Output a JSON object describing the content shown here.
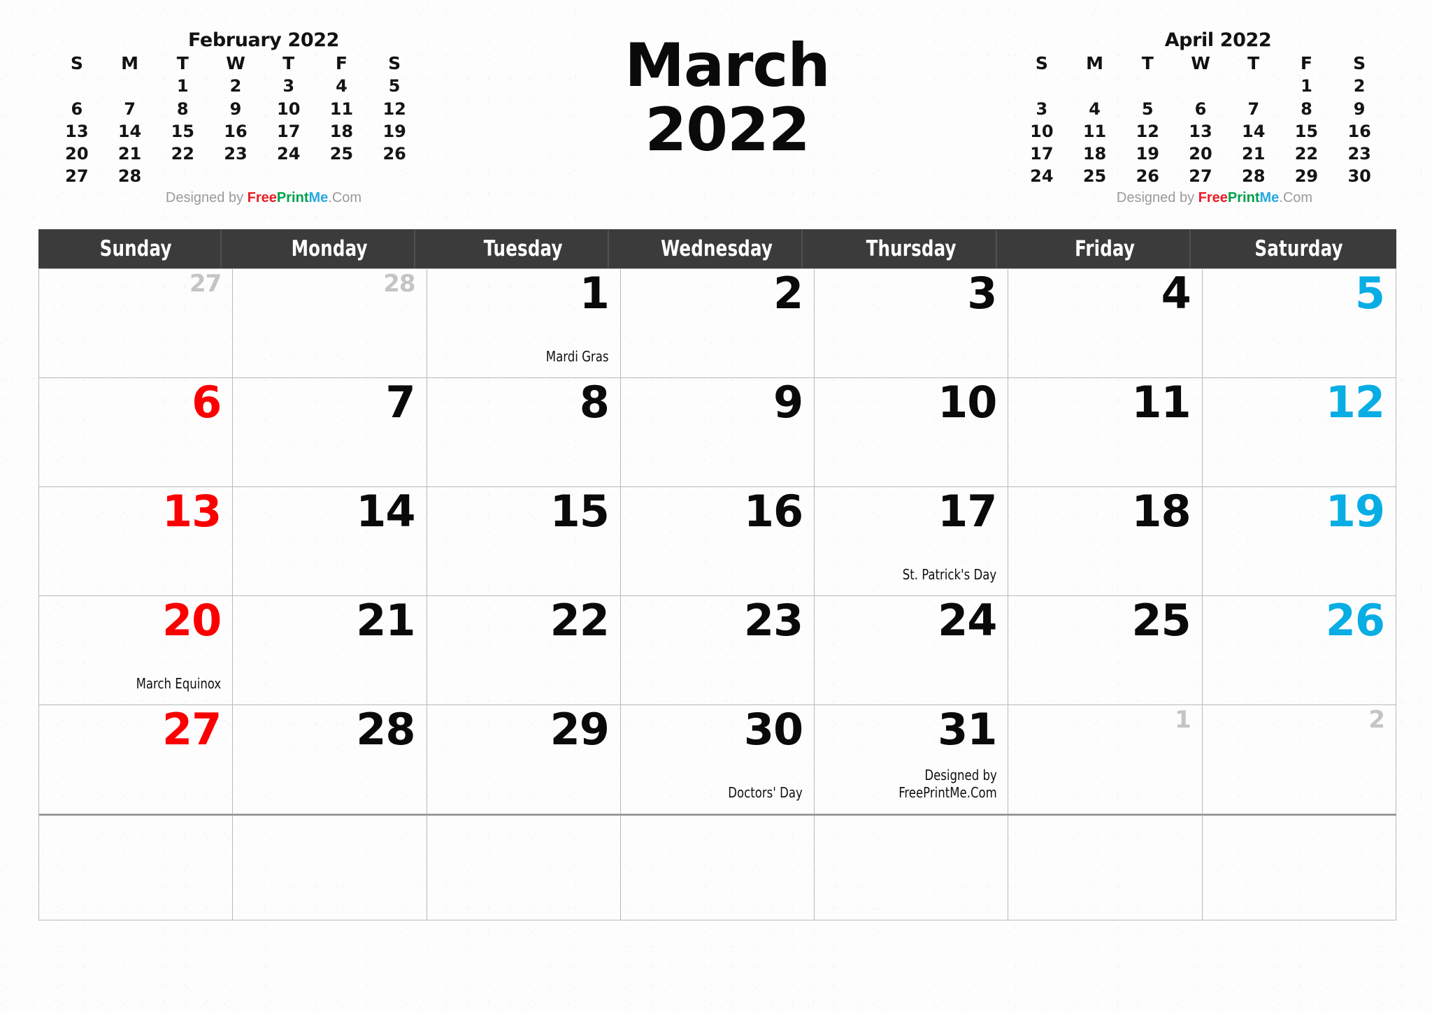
{
  "title": {
    "month": "March",
    "year": "2022"
  },
  "credit": {
    "prefix": "Designed by ",
    "free": "Free",
    "print": "Print",
    "me": "Me",
    "dotcom": ".Com",
    "colors": {
      "free": "#ec1c24",
      "print": "#00a14b",
      "me": "#27aae1",
      "plain": "#9a9a9a"
    }
  },
  "colors": {
    "header_bg": "#3b3b3b",
    "header_text": "#ffffff",
    "sunday": "#fb0000",
    "saturday": "#08ade4",
    "weekday": "#0a0a0a",
    "outside_day": "#c4c4c4",
    "grid_line": "#b9b9b9",
    "page_bg": "#fdfdfe"
  },
  "mini_calendars": [
    {
      "id": "february",
      "title": "February 2022",
      "dow": [
        "S",
        "M",
        "T",
        "W",
        "T",
        "F",
        "S"
      ],
      "weeks": [
        [
          "",
          "",
          "1",
          "2",
          "3",
          "4",
          "5"
        ],
        [
          "6",
          "7",
          "8",
          "9",
          "10",
          "11",
          "12"
        ],
        [
          "13",
          "14",
          "15",
          "16",
          "17",
          "18",
          "19"
        ],
        [
          "20",
          "21",
          "22",
          "23",
          "24",
          "25",
          "26"
        ],
        [
          "27",
          "28",
          "",
          "",
          "",
          "",
          ""
        ]
      ]
    },
    {
      "id": "april",
      "title": "April 2022",
      "dow": [
        "S",
        "M",
        "T",
        "W",
        "T",
        "F",
        "S"
      ],
      "weeks": [
        [
          "",
          "",
          "",
          "",
          "",
          "1",
          "2"
        ],
        [
          "3",
          "4",
          "5",
          "6",
          "7",
          "8",
          "9"
        ],
        [
          "10",
          "11",
          "12",
          "13",
          "14",
          "15",
          "16"
        ],
        [
          "17",
          "18",
          "19",
          "20",
          "21",
          "22",
          "23"
        ],
        [
          "24",
          "25",
          "26",
          "27",
          "28",
          "29",
          "30"
        ]
      ]
    }
  ],
  "weekday_headers": [
    "Sunday",
    "Monday",
    "Tuesday",
    "Wednesday",
    "Thursday",
    "Friday",
    "Saturday"
  ],
  "weeks": [
    [
      {
        "num": "27",
        "outside": true,
        "event": ""
      },
      {
        "num": "28",
        "outside": true,
        "event": ""
      },
      {
        "num": "1",
        "outside": false,
        "event": "Mardi Gras"
      },
      {
        "num": "2",
        "outside": false,
        "event": ""
      },
      {
        "num": "3",
        "outside": false,
        "event": ""
      },
      {
        "num": "4",
        "outside": false,
        "event": ""
      },
      {
        "num": "5",
        "outside": false,
        "event": ""
      }
    ],
    [
      {
        "num": "6",
        "outside": false,
        "event": ""
      },
      {
        "num": "7",
        "outside": false,
        "event": ""
      },
      {
        "num": "8",
        "outside": false,
        "event": ""
      },
      {
        "num": "9",
        "outside": false,
        "event": ""
      },
      {
        "num": "10",
        "outside": false,
        "event": ""
      },
      {
        "num": "11",
        "outside": false,
        "event": ""
      },
      {
        "num": "12",
        "outside": false,
        "event": ""
      }
    ],
    [
      {
        "num": "13",
        "outside": false,
        "event": ""
      },
      {
        "num": "14",
        "outside": false,
        "event": ""
      },
      {
        "num": "15",
        "outside": false,
        "event": ""
      },
      {
        "num": "16",
        "outside": false,
        "event": ""
      },
      {
        "num": "17",
        "outside": false,
        "event": "St. Patrick's Day"
      },
      {
        "num": "18",
        "outside": false,
        "event": ""
      },
      {
        "num": "19",
        "outside": false,
        "event": ""
      }
    ],
    [
      {
        "num": "20",
        "outside": false,
        "event": "March Equinox"
      },
      {
        "num": "21",
        "outside": false,
        "event": ""
      },
      {
        "num": "22",
        "outside": false,
        "event": ""
      },
      {
        "num": "23",
        "outside": false,
        "event": ""
      },
      {
        "num": "24",
        "outside": false,
        "event": ""
      },
      {
        "num": "25",
        "outside": false,
        "event": ""
      },
      {
        "num": "26",
        "outside": false,
        "event": ""
      }
    ],
    [
      {
        "num": "27",
        "outside": false,
        "event": ""
      },
      {
        "num": "28",
        "outside": false,
        "event": ""
      },
      {
        "num": "29",
        "outside": false,
        "event": ""
      },
      {
        "num": "30",
        "outside": false,
        "event": "Doctors' Day"
      },
      {
        "num": "31",
        "outside": false,
        "event": "Designed by\nFreePrintMe.Com"
      },
      {
        "num": "1",
        "outside": true,
        "event": ""
      },
      {
        "num": "2",
        "outside": true,
        "event": ""
      }
    ],
    [
      {
        "num": "",
        "outside": false,
        "event": ""
      },
      {
        "num": "",
        "outside": false,
        "event": ""
      },
      {
        "num": "",
        "outside": false,
        "event": ""
      },
      {
        "num": "",
        "outside": false,
        "event": ""
      },
      {
        "num": "",
        "outside": false,
        "event": ""
      },
      {
        "num": "",
        "outside": false,
        "event": ""
      },
      {
        "num": "",
        "outside": false,
        "event": ""
      }
    ]
  ]
}
